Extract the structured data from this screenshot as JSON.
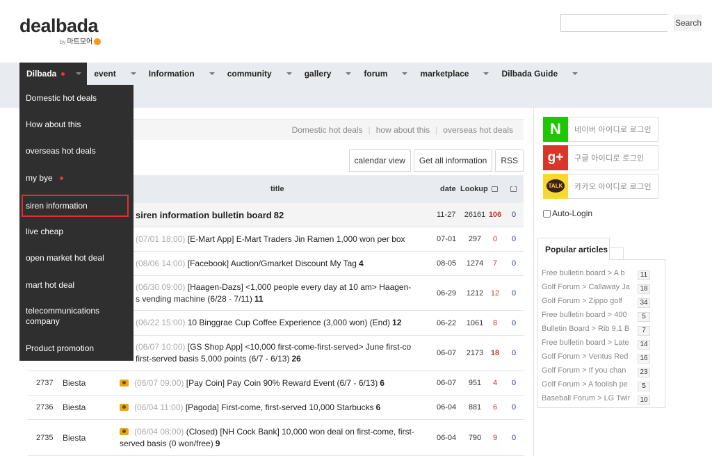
{
  "header": {
    "logo_main": "dealbada",
    "logo_by": "by",
    "logo_sub": "마트모어",
    "search_label": "Search",
    "search_placeholder": ""
  },
  "nav": {
    "items": [
      {
        "label": "Dilbada"
      },
      {
        "label": "event"
      },
      {
        "label": "Information"
      },
      {
        "label": "community"
      },
      {
        "label": "gallery"
      },
      {
        "label": "forum"
      },
      {
        "label": "marketplace"
      },
      {
        "label": "Dilbada Guide"
      }
    ]
  },
  "dropdown": {
    "items": [
      {
        "label": "Domestic hot deals"
      },
      {
        "label": "How about this"
      },
      {
        "label": "overseas hot deals"
      },
      {
        "label": "my bye"
      },
      {
        "label": "siren information"
      },
      {
        "label": "live cheap"
      },
      {
        "label": "open market hot deal"
      },
      {
        "label": "mart hot deal"
      },
      {
        "label": "telecommunications company"
      },
      {
        "label": "Product promotion"
      }
    ]
  },
  "breadcrumbs": [
    "Domestic hot deals",
    "how about this",
    "overseas hot deals"
  ],
  "toolbar": {
    "calendar": "calendar view",
    "getall": "Get all information",
    "rss": "RSS"
  },
  "table": {
    "headers": {
      "title": "title",
      "date": "date",
      "lookup": "Lookup"
    },
    "rows": [
      {
        "no": "",
        "writer": "",
        "time": "",
        "title": "siren information bulletin board",
        "count": "82",
        "date": "11-27",
        "lookup": "26161",
        "up": "106",
        "down": "0"
      },
      {
        "no": "",
        "writer": "",
        "time": "(07/01 18:00)",
        "title": "[E-Mart App] E-Mart Traders Jin Ramen 1,000 won per box",
        "count": "",
        "date": "07-01",
        "lookup": "297",
        "up": "0",
        "down": "0"
      },
      {
        "no": "",
        "writer": "",
        "time": "(08/06 14:00)",
        "title": "[Facebook] Auction/Gmarket Discount My Tag",
        "count": "4",
        "date": "08-05",
        "lookup": "1274",
        "up": "7",
        "down": "0"
      },
      {
        "no": "",
        "writer": "",
        "time": "(06/30 09:00)",
        "title": "[Haagen-Dazs] <1,000 people every day at 10 am> Haagen-",
        "title2": "s vending machine (6/28 - 7/11)",
        "count": "11",
        "date": "06-29",
        "lookup": "1212",
        "up": "12",
        "down": "0"
      },
      {
        "no": "",
        "writer": "",
        "time": "(06/22 15:00)",
        "title": "10 Binggrae Cup Coffee Experience (3,000 won) (End)",
        "count": "12",
        "date": "06-22",
        "lookup": "1061",
        "up": "8",
        "down": "0"
      },
      {
        "no": "",
        "writer": "",
        "time": "(06/07 10:00)",
        "title": "[GS Shop App] <10,000 first-come-first-served> June first-co",
        "title2": "first-served basis 5,000 points (6/7 - 6/13)",
        "count": "26",
        "date": "06-07",
        "lookup": "2173",
        "up": "18",
        "down": "0"
      },
      {
        "no": "2737",
        "writer": "Biesta",
        "time": "(06/07 09:00)",
        "title": "[Pay Coin] Pay Coin 90% Reward Event (6/7 - 6/13)",
        "count": "6",
        "date": "06-07",
        "lookup": "951",
        "up": "4",
        "down": "0"
      },
      {
        "no": "2736",
        "writer": "Biesta",
        "time": "(06/04 11:00)",
        "title": "[Pagoda] First-come, first-served 10,000 Starbucks",
        "count": "6",
        "date": "06-04",
        "lookup": "881",
        "up": "6",
        "down": "0"
      },
      {
        "no": "2735",
        "writer": "Biesta",
        "time": "(06/04 08:00)",
        "title": "(Closed) [NH Cock Bank] 10,000 won deal on first-come, first-",
        "title2": "served basis (0 won/free)",
        "count": "9",
        "date": "06-04",
        "lookup": "790",
        "up": "9",
        "down": "0"
      }
    ]
  },
  "login": {
    "naver": "네이버 아이디로 로그인",
    "naver_icon": "N",
    "google": "구글 아이디로 로그인",
    "google_icon": "g+",
    "kakao": "카카오 아이디로 로그인",
    "kakao_icon": "TALK",
    "auto": "Auto-Login"
  },
  "popular": {
    "title": "Popular articles",
    "items": [
      {
        "text": "Free bulletin board > A b",
        "count": "11"
      },
      {
        "text": "Golf Forum > Callaway Ja",
        "count": "18"
      },
      {
        "text": "Golf Forum > Zippo golf",
        "count": "34"
      },
      {
        "text": "Free bulletin board > 400",
        "count": "5"
      },
      {
        "text": "Bulletin Board > Rib 9.1 B",
        "count": "7"
      },
      {
        "text": "Free bulletin board > Late",
        "count": "14"
      },
      {
        "text": "Golf Forum > Ventus Red",
        "count": "16"
      },
      {
        "text": "Golf Forum > If you chan",
        "count": "23"
      },
      {
        "text": "Golf Forum > A foolish pe",
        "count": "5"
      },
      {
        "text": "Baseball Forum > LG Twir",
        "count": "10"
      }
    ]
  },
  "colors": {
    "accent_red": "#e53935",
    "nav_bg": "#e8ecf1",
    "dropdown_bg": "#2f2f2f",
    "highlight_outline": "#e03030"
  }
}
